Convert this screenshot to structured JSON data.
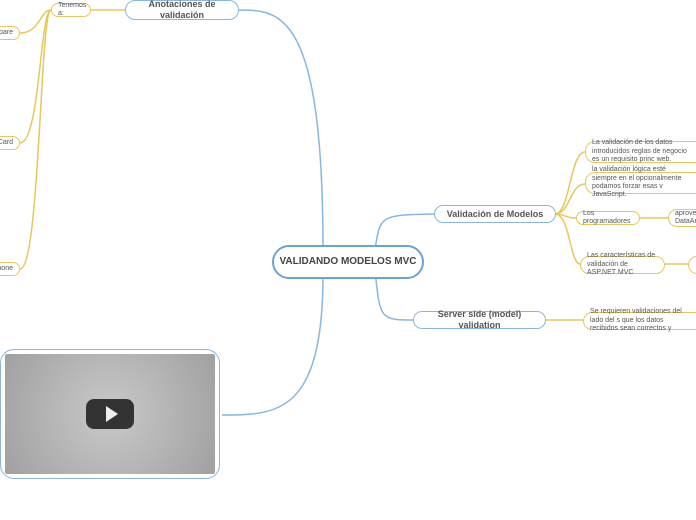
{
  "root": {
    "title": "VALIDANDO MODELOS MVC"
  },
  "branches": {
    "anotaciones": {
      "title": "Anotaciones de validación",
      "tenemos": "Tenemos a:",
      "compare": "mpare",
      "card": "itCard",
      "phone": "Phone"
    },
    "validacion": {
      "title": "Validación de Modelos",
      "note1": "La validación de los datos introducidos reglas de negocio es un requisito princ web.",
      "note2": "la validación lógica esté siempre en el opcionalmente podamos forzar esas v JavaScript.",
      "prog": "Los programadores",
      "prog_sub": "aprove DataAn",
      "note4": "Las características de validación de ASP.NET MVC"
    },
    "server": {
      "title": "Server side (model) validation",
      "note": "Se requieren validaciones del lado del s que los datos recibidos sean correctos y"
    }
  }
}
